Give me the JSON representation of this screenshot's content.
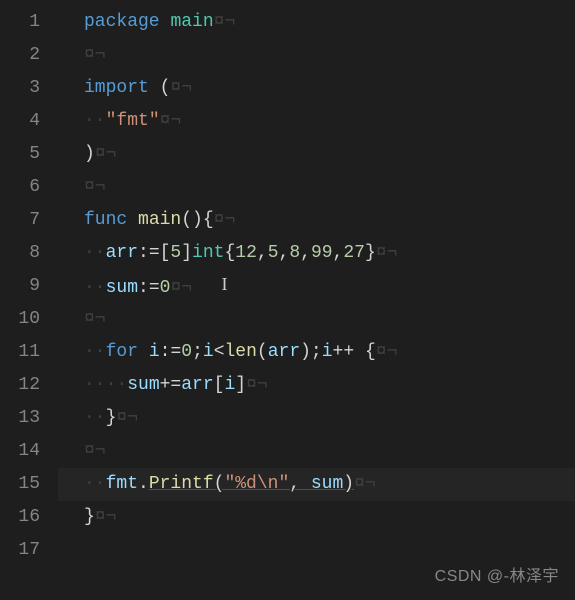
{
  "editor": {
    "language": "go",
    "active_line": 15,
    "watermark": "CSDN @-林泽宇",
    "line_numbers": [
      "1",
      "2",
      "3",
      "4",
      "5",
      "6",
      "7",
      "8",
      "9",
      "10",
      "11",
      "12",
      "13",
      "14",
      "15",
      "16",
      "17"
    ],
    "ws_eol_glyph": "¤¬",
    "lines": {
      "l1": {
        "t0": "package",
        "t1": " ",
        "t2": "main"
      },
      "l2": {},
      "l3": {
        "t0": "import",
        "t1": " ("
      },
      "l4": {
        "indent": 1,
        "t0": "\"fmt\""
      },
      "l5": {
        "t0": ")"
      },
      "l6": {},
      "l7": {
        "t0": "func",
        "t1": " ",
        "t2": "main",
        "t3": "(){"
      },
      "l8": {
        "indent": 1,
        "t0": "arr",
        "t1": ":=[",
        "t2": "5",
        "t3": "]",
        "t4": "int",
        "t5": "{",
        "t6": "12",
        "t7": ",",
        "t8": "5",
        "t9": ",",
        "t10": "8",
        "t11": ",",
        "t12": "99",
        "t13": ",",
        "t14": "27",
        "t15": "}"
      },
      "l9": {
        "indent": 1,
        "t0": "sum",
        "t1": ":=",
        "t2": "0"
      },
      "l10": {},
      "l11": {
        "indent": 1,
        "t0": "for",
        "t1": " ",
        "t2": "i",
        "t3": ":=",
        "t4": "0",
        "t5": ";",
        "t6": "i",
        "t7": "<",
        "t8": "len",
        "t9": "(",
        "t10": "arr",
        "t11": ");",
        "t12": "i",
        "t13": "++ {"
      },
      "l12": {
        "indent": 2,
        "t0": "sum",
        "t1": "+=",
        "t2": "arr",
        "t3": "[",
        "t4": "i",
        "t5": "]"
      },
      "l13": {
        "indent": 1,
        "t0": "}"
      },
      "l14": {},
      "l15": {
        "indent": 1,
        "t0": "fmt",
        "t1": ".",
        "t2": "Printf",
        "t3": "(",
        "t4": "\"%d\\n\"",
        "t5": ", ",
        "t6": "sum",
        "t7": ")"
      },
      "l16": {
        "t0": "}"
      },
      "l17": {}
    }
  }
}
